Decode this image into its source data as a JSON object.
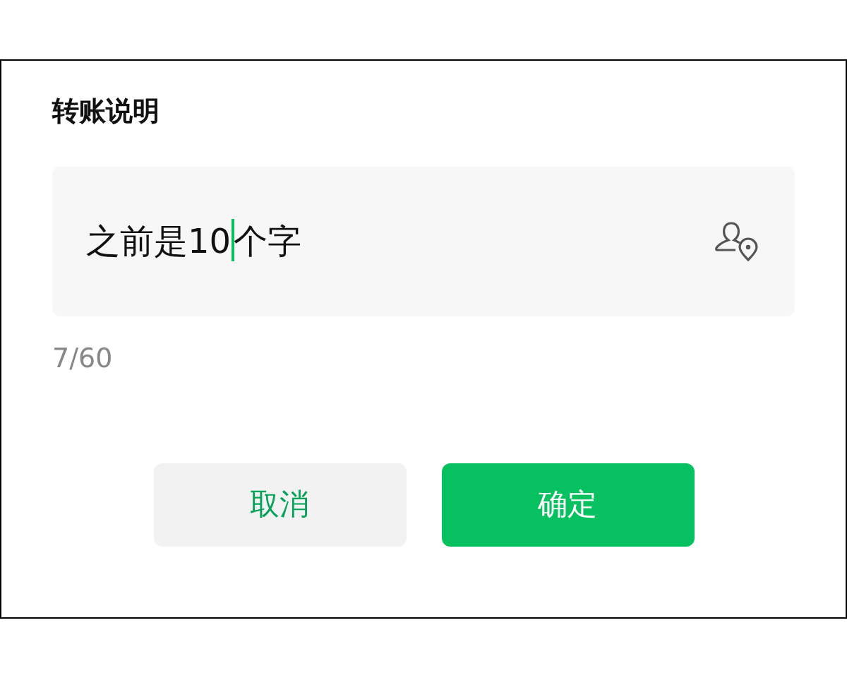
{
  "dialog": {
    "title": "转账说明"
  },
  "field": {
    "text_before_cursor": "之前是10",
    "text_after_cursor": "个字",
    "focused": true
  },
  "counter": "7/60",
  "buttons": [
    {
      "label": "取消",
      "kind": "secondary"
    },
    {
      "label": "确定",
      "kind": "primary"
    }
  ]
}
